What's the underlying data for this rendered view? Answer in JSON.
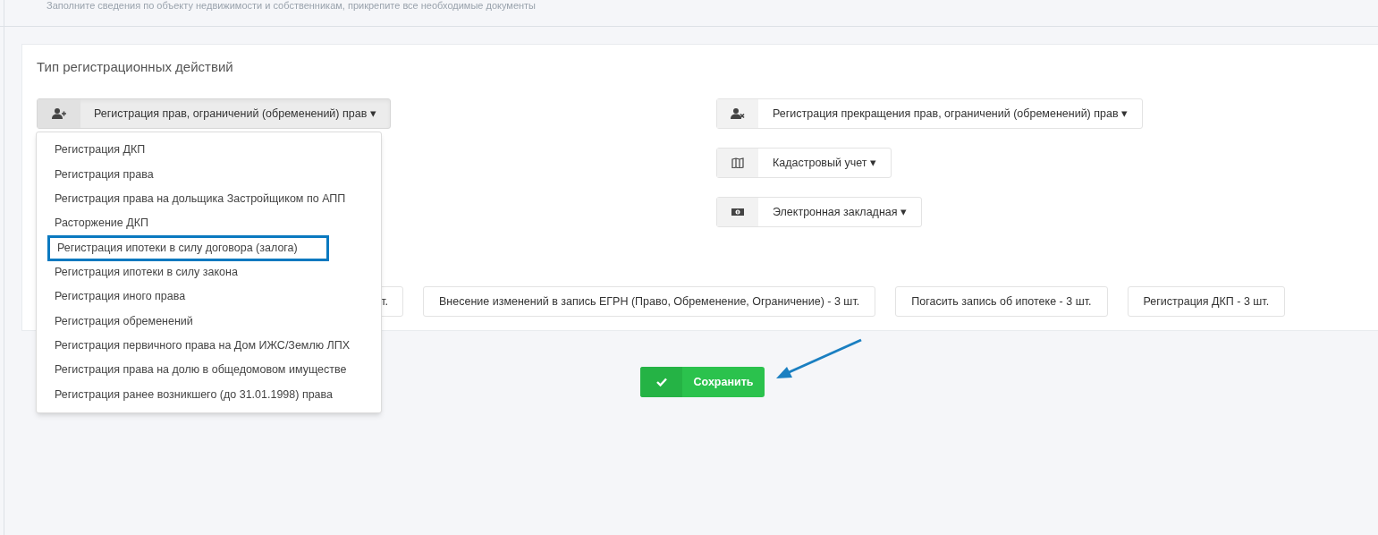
{
  "header": {
    "subtitle": "Заполните сведения по объекту недвижимости и собственникам, прикрепите все необходимые документы"
  },
  "card": {
    "title": "Тип регистрационных действий",
    "left_dropdown": {
      "label": "Регистрация прав, ограничений (обременений) прав",
      "caret": "▾",
      "expanded": true,
      "items": [
        {
          "label": "Регистрация ДКП",
          "highlighted": false
        },
        {
          "label": "Регистрация права",
          "highlighted": false
        },
        {
          "label": "Регистрация права на дольщика Застройщиком по АПП",
          "highlighted": false
        },
        {
          "label": "Расторжение ДКП",
          "highlighted": false
        },
        {
          "label": "Регистрация ипотеки в силу договора (залога)",
          "highlighted": true
        },
        {
          "label": "Регистрация ипотеки в силу закона",
          "highlighted": false
        },
        {
          "label": "Регистрация иного права",
          "highlighted": false
        },
        {
          "label": "Регистрация обременений",
          "highlighted": false
        },
        {
          "label": "Регистрация первичного права на Дом ИЖС/Землю ЛПХ",
          "highlighted": false
        },
        {
          "label": "Регистрация права на долю в общедомовом имуществе",
          "highlighted": false
        },
        {
          "label": "Регистрация ранее возникшего (до 31.01.1998) права",
          "highlighted": false
        }
      ]
    },
    "right_dropdowns": [
      {
        "kind": "user-remove",
        "label": "Регистрация прекращения прав, ограничений (обременений) прав",
        "caret": "▾"
      },
      {
        "kind": "map",
        "label": "Кадастровый учет",
        "caret": "▾"
      },
      {
        "kind": "money",
        "label": "Электронная закладная",
        "caret": "▾"
      }
    ],
    "quick_buttons": [
      {
        "label": "т.",
        "partly_hidden": true
      },
      {
        "label": "Внесение изменений в запись ЕГРН (Право, Обременение, Ограничение) - 3 шт.",
        "partly_hidden": false
      },
      {
        "label": "Погасить запись об ипотеке - 3 шт.",
        "partly_hidden": false
      },
      {
        "label": "Регистрация ДКП - 3 шт.",
        "partly_hidden": false
      }
    ]
  },
  "save_button": {
    "label": "Сохранить"
  },
  "annotation": {
    "arrow": true
  }
}
